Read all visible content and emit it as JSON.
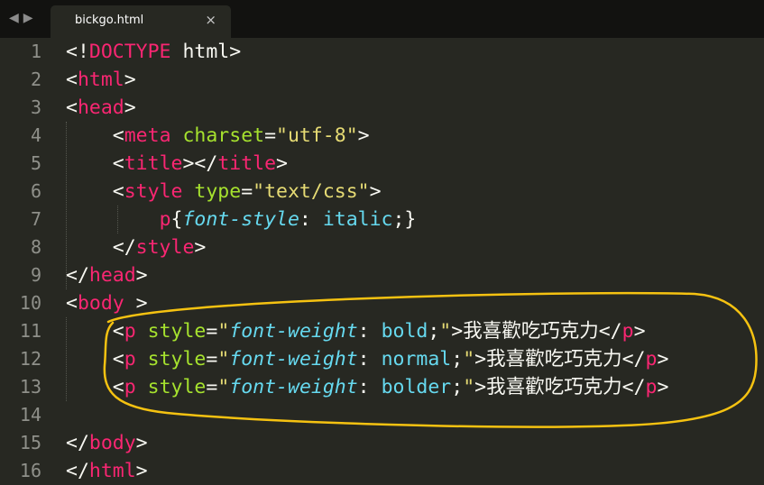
{
  "tab": {
    "title": "bickgo.html",
    "close_glyph": "×"
  },
  "nav": {
    "back_glyph": "◀",
    "forward_glyph": "▶"
  },
  "line_numbers": [
    "1",
    "2",
    "3",
    "4",
    "5",
    "6",
    "7",
    "8",
    "9",
    "10",
    "11",
    "12",
    "13",
    "14",
    "15",
    "16"
  ],
  "lines": [
    [
      {
        "t": "<!",
        "c": ""
      },
      {
        "t": "DOCTYPE",
        "c": "tag"
      },
      {
        "t": " html>",
        "c": ""
      }
    ],
    [
      {
        "t": "<",
        "c": ""
      },
      {
        "t": "html",
        "c": "tag"
      },
      {
        "t": ">",
        "c": ""
      }
    ],
    [
      {
        "t": "<",
        "c": ""
      },
      {
        "t": "head",
        "c": "tag"
      },
      {
        "t": ">",
        "c": ""
      }
    ],
    [
      {
        "t": "    <",
        "c": ""
      },
      {
        "t": "meta",
        "c": "tag"
      },
      {
        "t": " ",
        "c": ""
      },
      {
        "t": "charset",
        "c": "attr"
      },
      {
        "t": "=",
        "c": ""
      },
      {
        "t": "\"utf-8\"",
        "c": "str"
      },
      {
        "t": ">",
        "c": ""
      }
    ],
    [
      {
        "t": "    <",
        "c": ""
      },
      {
        "t": "title",
        "c": "tag"
      },
      {
        "t": "></",
        "c": ""
      },
      {
        "t": "title",
        "c": "tag"
      },
      {
        "t": ">",
        "c": ""
      }
    ],
    [
      {
        "t": "    <",
        "c": ""
      },
      {
        "t": "style",
        "c": "tag"
      },
      {
        "t": " ",
        "c": ""
      },
      {
        "t": "type",
        "c": "attr"
      },
      {
        "t": "=",
        "c": ""
      },
      {
        "t": "\"text/css\"",
        "c": "str"
      },
      {
        "t": ">",
        "c": ""
      }
    ],
    [
      {
        "t": "        ",
        "c": ""
      },
      {
        "t": "p",
        "c": "tag"
      },
      {
        "t": "{",
        "c": ""
      },
      {
        "t": "font-style",
        "c": "prop"
      },
      {
        "t": ": ",
        "c": ""
      },
      {
        "t": "italic",
        "c": "val"
      },
      {
        "t": ";}",
        "c": ""
      }
    ],
    [
      {
        "t": "    </",
        "c": ""
      },
      {
        "t": "style",
        "c": "tag"
      },
      {
        "t": ">",
        "c": ""
      }
    ],
    [
      {
        "t": "</",
        "c": ""
      },
      {
        "t": "head",
        "c": "tag"
      },
      {
        "t": ">",
        "c": ""
      }
    ],
    [
      {
        "t": "<",
        "c": ""
      },
      {
        "t": "body",
        "c": "tag"
      },
      {
        "t": " >",
        "c": ""
      }
    ],
    [
      {
        "t": "    <",
        "c": ""
      },
      {
        "t": "p",
        "c": "tag"
      },
      {
        "t": " ",
        "c": ""
      },
      {
        "t": "style",
        "c": "attr"
      },
      {
        "t": "=",
        "c": ""
      },
      {
        "t": "\"",
        "c": "str"
      },
      {
        "t": "font-weight",
        "c": "prop"
      },
      {
        "t": ": ",
        "c": ""
      },
      {
        "t": "bold",
        "c": "val"
      },
      {
        "t": ";",
        "c": ""
      },
      {
        "t": "\"",
        "c": "str"
      },
      {
        "t": ">",
        "c": ""
      },
      {
        "t": "我喜歡吃巧克力",
        "c": "cjk"
      },
      {
        "t": "</",
        "c": ""
      },
      {
        "t": "p",
        "c": "tag"
      },
      {
        "t": ">",
        "c": ""
      }
    ],
    [
      {
        "t": "    <",
        "c": ""
      },
      {
        "t": "p",
        "c": "tag"
      },
      {
        "t": " ",
        "c": ""
      },
      {
        "t": "style",
        "c": "attr"
      },
      {
        "t": "=",
        "c": ""
      },
      {
        "t": "\"",
        "c": "str"
      },
      {
        "t": "font-weight",
        "c": "prop"
      },
      {
        "t": ": ",
        "c": ""
      },
      {
        "t": "normal",
        "c": "val"
      },
      {
        "t": ";",
        "c": ""
      },
      {
        "t": "\"",
        "c": "str"
      },
      {
        "t": ">",
        "c": ""
      },
      {
        "t": "我喜歡吃巧克力",
        "c": "cjk"
      },
      {
        "t": "</",
        "c": ""
      },
      {
        "t": "p",
        "c": "tag"
      },
      {
        "t": ">",
        "c": ""
      }
    ],
    [
      {
        "t": "    <",
        "c": ""
      },
      {
        "t": "p",
        "c": "tag"
      },
      {
        "t": " ",
        "c": ""
      },
      {
        "t": "style",
        "c": "attr"
      },
      {
        "t": "=",
        "c": ""
      },
      {
        "t": "\"",
        "c": "str"
      },
      {
        "t": "font-weight",
        "c": "prop"
      },
      {
        "t": ": ",
        "c": ""
      },
      {
        "t": "bolder",
        "c": "val"
      },
      {
        "t": ";",
        "c": ""
      },
      {
        "t": "\"",
        "c": "str"
      },
      {
        "t": ">",
        "c": ""
      },
      {
        "t": "我喜歡吃巧克力",
        "c": "cjk"
      },
      {
        "t": "</",
        "c": ""
      },
      {
        "t": "p",
        "c": "tag"
      },
      {
        "t": ">",
        "c": ""
      }
    ],
    [],
    [
      {
        "t": "</",
        "c": ""
      },
      {
        "t": "body",
        "c": "tag"
      },
      {
        "t": ">",
        "c": ""
      }
    ],
    [
      {
        "t": "</",
        "c": ""
      },
      {
        "t": "html",
        "c": "tag"
      },
      {
        "t": ">",
        "c": ""
      }
    ]
  ],
  "colors": {
    "background": "#272822",
    "tabbar": "#121210",
    "tag": "#f92672",
    "attribute": "#a6e22e",
    "string": "#e6db74",
    "keyword": "#66d9ef",
    "text": "#f8f8f2",
    "gutter": "#8f908a",
    "annotation": "#f5c211"
  }
}
